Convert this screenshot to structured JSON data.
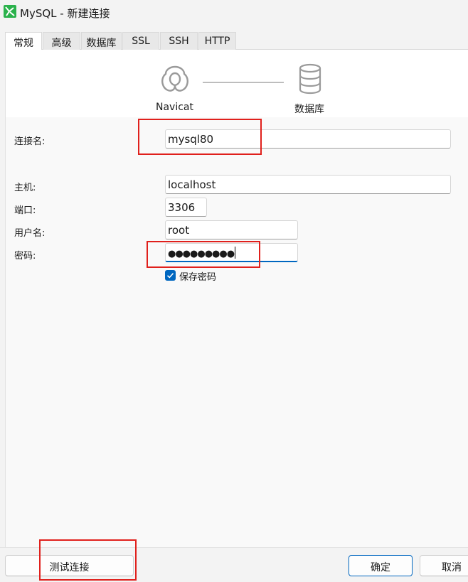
{
  "window": {
    "title": "MySQL - 新建连接",
    "icon": "navicat-mysql-icon"
  },
  "tabs": [
    {
      "label": "常规",
      "active": true
    },
    {
      "label": "高级",
      "active": false
    },
    {
      "label": "数据库",
      "active": false
    },
    {
      "label": "SSL",
      "active": false
    },
    {
      "label": "SSH",
      "active": false
    },
    {
      "label": "HTTP",
      "active": false
    }
  ],
  "banner": {
    "left_label": "Navicat",
    "right_label": "数据库",
    "left_icon": "navicat-logo-icon",
    "right_icon": "database-icon"
  },
  "form": {
    "connection_name": {
      "label": "连接名:",
      "value": "mysql80"
    },
    "host": {
      "label": "主机:",
      "value": "localhost"
    },
    "port": {
      "label": "端口:",
      "value": "3306"
    },
    "username": {
      "label": "用户名:",
      "value": "root"
    },
    "password": {
      "label": "密码:",
      "value": "●●●●●●●●●"
    },
    "save_password": {
      "label": "保存密码",
      "checked": true
    }
  },
  "buttons": {
    "test": "测试连接",
    "ok": "确定",
    "cancel": "取消"
  },
  "colors": {
    "accent": "#0067c0",
    "highlight": "#e0201c",
    "app_icon": "#2bb24c"
  }
}
